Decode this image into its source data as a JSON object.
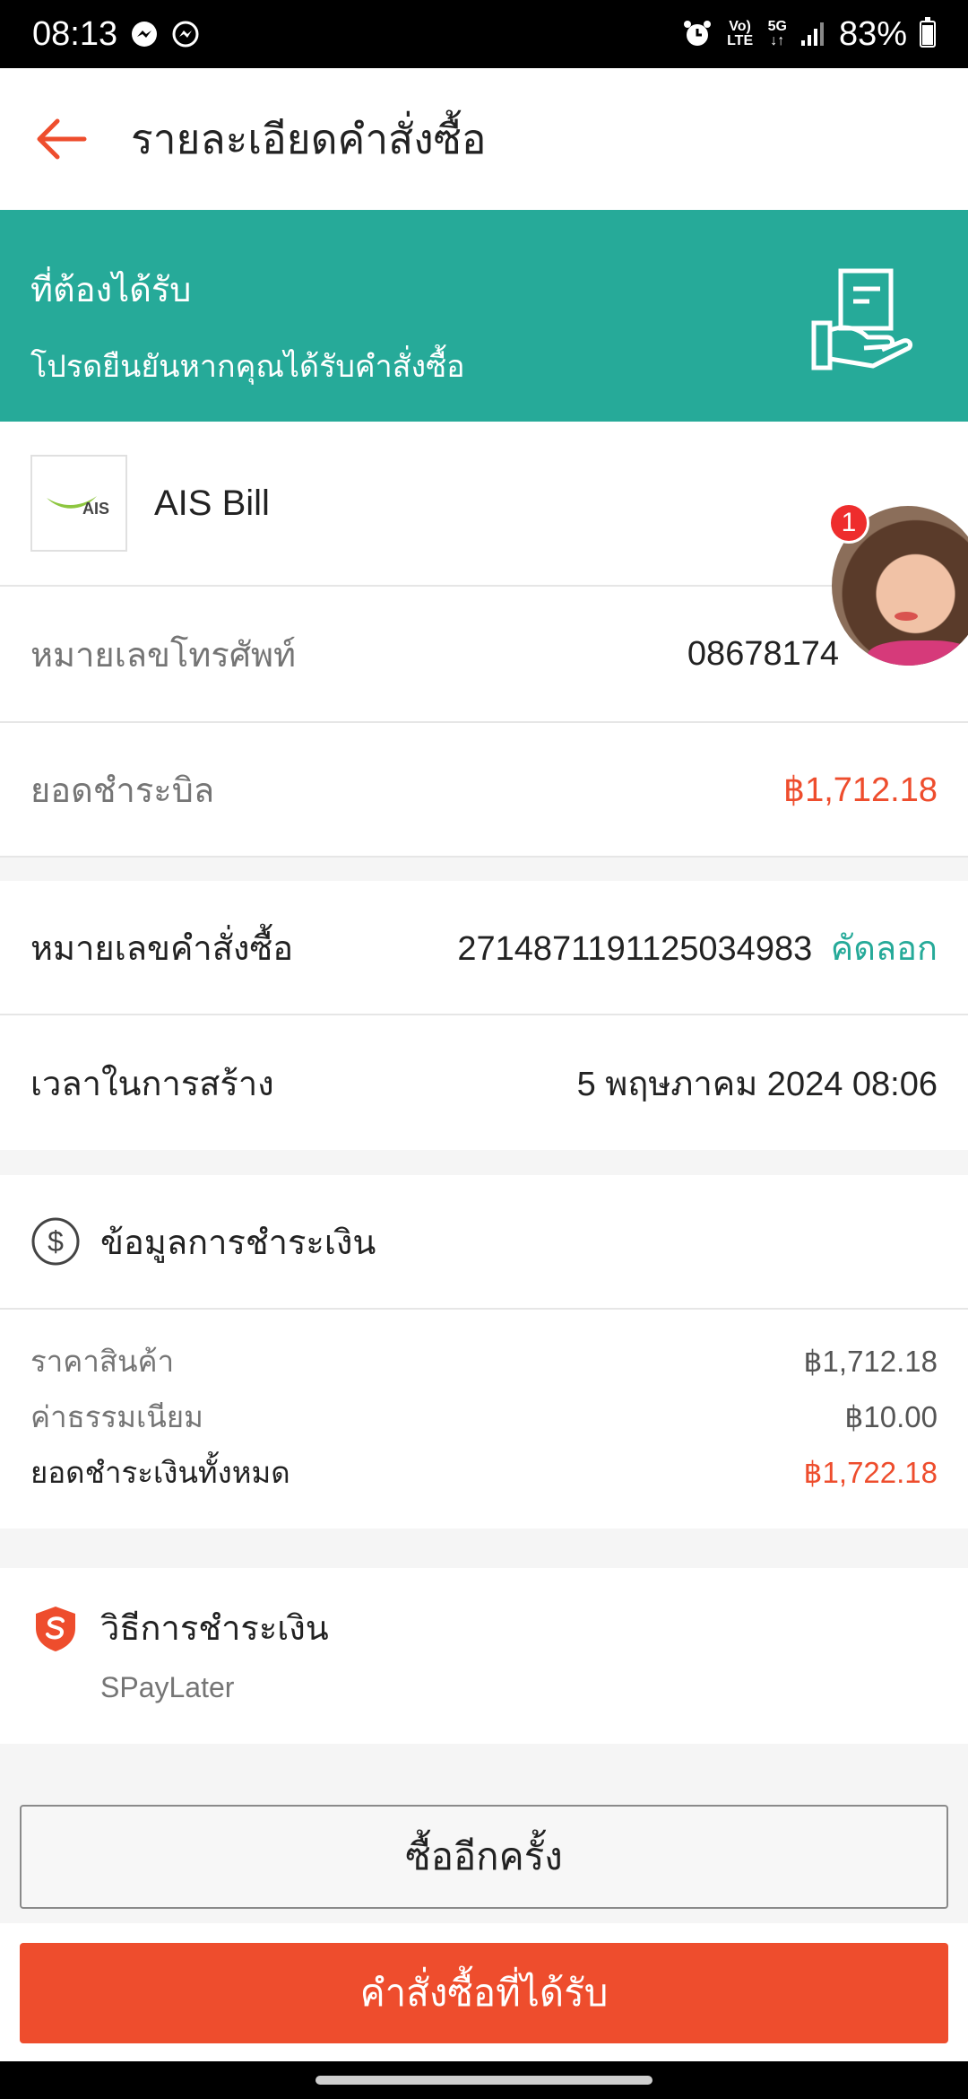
{
  "status_bar": {
    "time": "08:13",
    "battery": "83%",
    "battery_level": 0.83,
    "network_5g": "5G",
    "volte": "Vo) LTE",
    "icons": [
      "messenger-icon",
      "messenger-icon",
      "alarm-icon",
      "volte-icon",
      "5g-icon",
      "signal-icon",
      "battery-icon"
    ]
  },
  "header": {
    "title": "รายละเอียดคำสั่งซื้อ",
    "back_icon": "arrow-left-icon"
  },
  "banner": {
    "title": "ที่ต้องได้รับ",
    "subtitle": "โปรดยืนยันหากคุณได้รับคำสั่งซื้อ",
    "icon": "receipt-hand-icon",
    "color": "#26aa99"
  },
  "merchant": {
    "logo_text": "AIS",
    "name": "AIS Bill"
  },
  "chat_bubble": {
    "badge": "1"
  },
  "bill": {
    "phone_label": "หมายเลขโทรศัพท์",
    "phone_value": "08678174",
    "amount_label": "ยอดชำระบิล",
    "amount_value": "฿1,712.18"
  },
  "order": {
    "id_label": "หมายเลขคำสั่งซื้อ",
    "id_value": "2714871191125034983",
    "copy_label": "คัดลอก",
    "created_label": "เวลาในการสร้าง",
    "created_value": "5 พฤษภาคม 2024 08:06"
  },
  "payment_info": {
    "title": "ข้อมูลการชำระเงิน",
    "icon": "dollar-circle-icon",
    "lines": [
      {
        "label": "ราคาสินค้า",
        "value": "฿1,712.18"
      },
      {
        "label": "ค่าธรรมเนียม",
        "value": "฿10.00"
      },
      {
        "label": "ยอดชำระเงินทั้งหมด",
        "value": "฿1,722.18"
      }
    ]
  },
  "payment_method": {
    "title": "วิธีการชำระเงิน",
    "value": "SPayLater",
    "icon": "shield-s-icon"
  },
  "buttons": {
    "buy_again": "ซื้ออีกครั้ง",
    "order_received": "คำสั่งซื้อที่ได้รับ"
  },
  "colors": {
    "accent": "#ee4d2d",
    "teal": "#26aa99"
  }
}
